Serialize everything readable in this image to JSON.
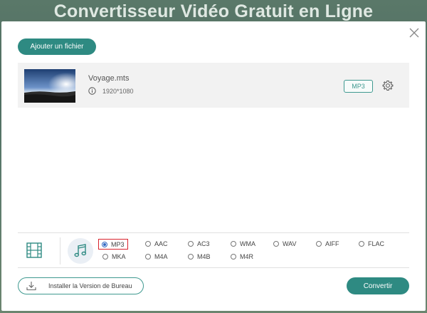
{
  "page": {
    "title": "Convertisseur Vidéo Gratuit en Ligne"
  },
  "dialog": {
    "add_file_label": "Ajouter un fichier",
    "close_icon": "close-icon"
  },
  "file": {
    "name": "Voyage.mts",
    "resolution": "1920*1080",
    "output_format": "MP3",
    "info_icon": "info-icon",
    "settings_icon": "gear-icon"
  },
  "formats": {
    "tabs": [
      {
        "name": "video",
        "icon": "film-icon",
        "active": false
      },
      {
        "name": "audio",
        "icon": "music-note-icon",
        "active": true
      }
    ],
    "audio_options": [
      {
        "label": "MP3",
        "selected": true
      },
      {
        "label": "AAC",
        "selected": false
      },
      {
        "label": "AC3",
        "selected": false
      },
      {
        "label": "WMA",
        "selected": false
      },
      {
        "label": "WAV",
        "selected": false
      },
      {
        "label": "AIFF",
        "selected": false
      },
      {
        "label": "FLAC",
        "selected": false
      },
      {
        "label": "MKA",
        "selected": false
      },
      {
        "label": "M4A",
        "selected": false
      },
      {
        "label": "M4B",
        "selected": false
      },
      {
        "label": "M4R",
        "selected": false
      }
    ]
  },
  "footer": {
    "install_label": "Installer la Version de Bureau",
    "install_icon": "download-icon",
    "convert_label": "Convertir"
  },
  "colors": {
    "accent": "#2e8a82",
    "selection_border": "#d9232d",
    "radio_selected": "#2f68c4"
  }
}
